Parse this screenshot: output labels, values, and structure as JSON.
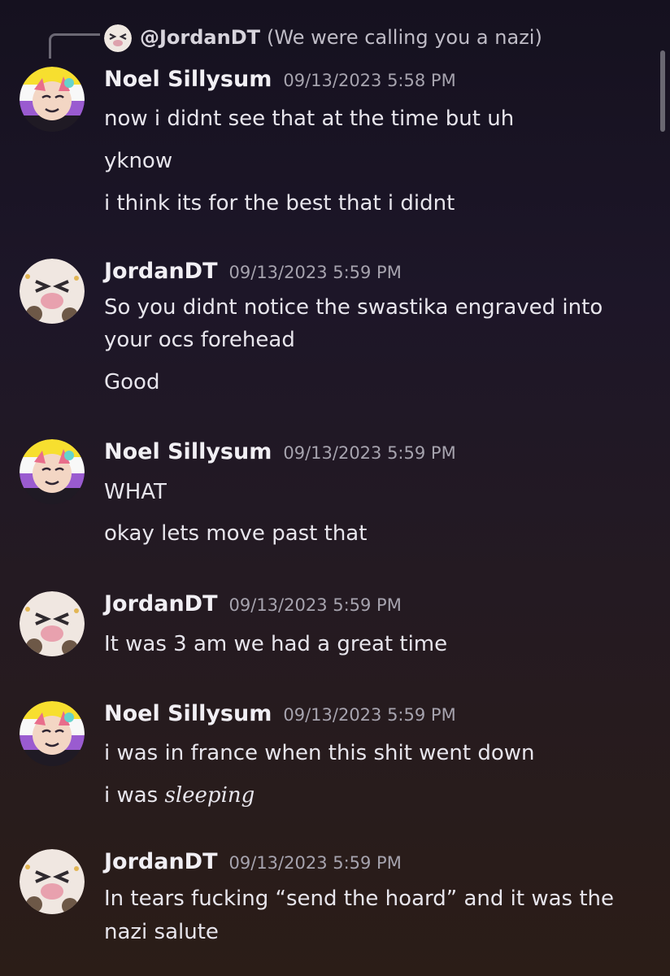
{
  "reply": {
    "username": "@JordanDT",
    "content": "(We were calling you a nazi)"
  },
  "messages": [
    {
      "author": "Noel Sillysum",
      "timestamp": "09/13/2023 5:58 PM",
      "lines": [
        "now i didnt see that at the time but uh",
        "yknow",
        "i think its for the best that i didnt"
      ]
    },
    {
      "author": "JordanDT",
      "timestamp": "09/13/2023 5:59 PM",
      "lines": [
        "So you didnt notice the swastika engraved into",
        "your ocs forehead",
        "Good"
      ]
    },
    {
      "author": "Noel Sillysum",
      "timestamp": "09/13/2023 5:59 PM",
      "lines": [
        "WHAT",
        "okay lets move past that"
      ]
    },
    {
      "author": "JordanDT",
      "timestamp": "09/13/2023 5:59 PM",
      "lines": [
        "It was 3 am we had a great time"
      ]
    },
    {
      "author": "Noel Sillysum",
      "timestamp": "09/13/2023 5:59 PM",
      "lines": [
        "i was in france when this shit went down"
      ],
      "mixed_line": {
        "prefix": "i was ",
        "italic": "sleeping"
      }
    },
    {
      "author": "JordanDT",
      "timestamp": "09/13/2023 5:59 PM",
      "lines": [
        "In tears fucking “send the hoard” and it was the",
        "nazi salute"
      ]
    }
  ]
}
